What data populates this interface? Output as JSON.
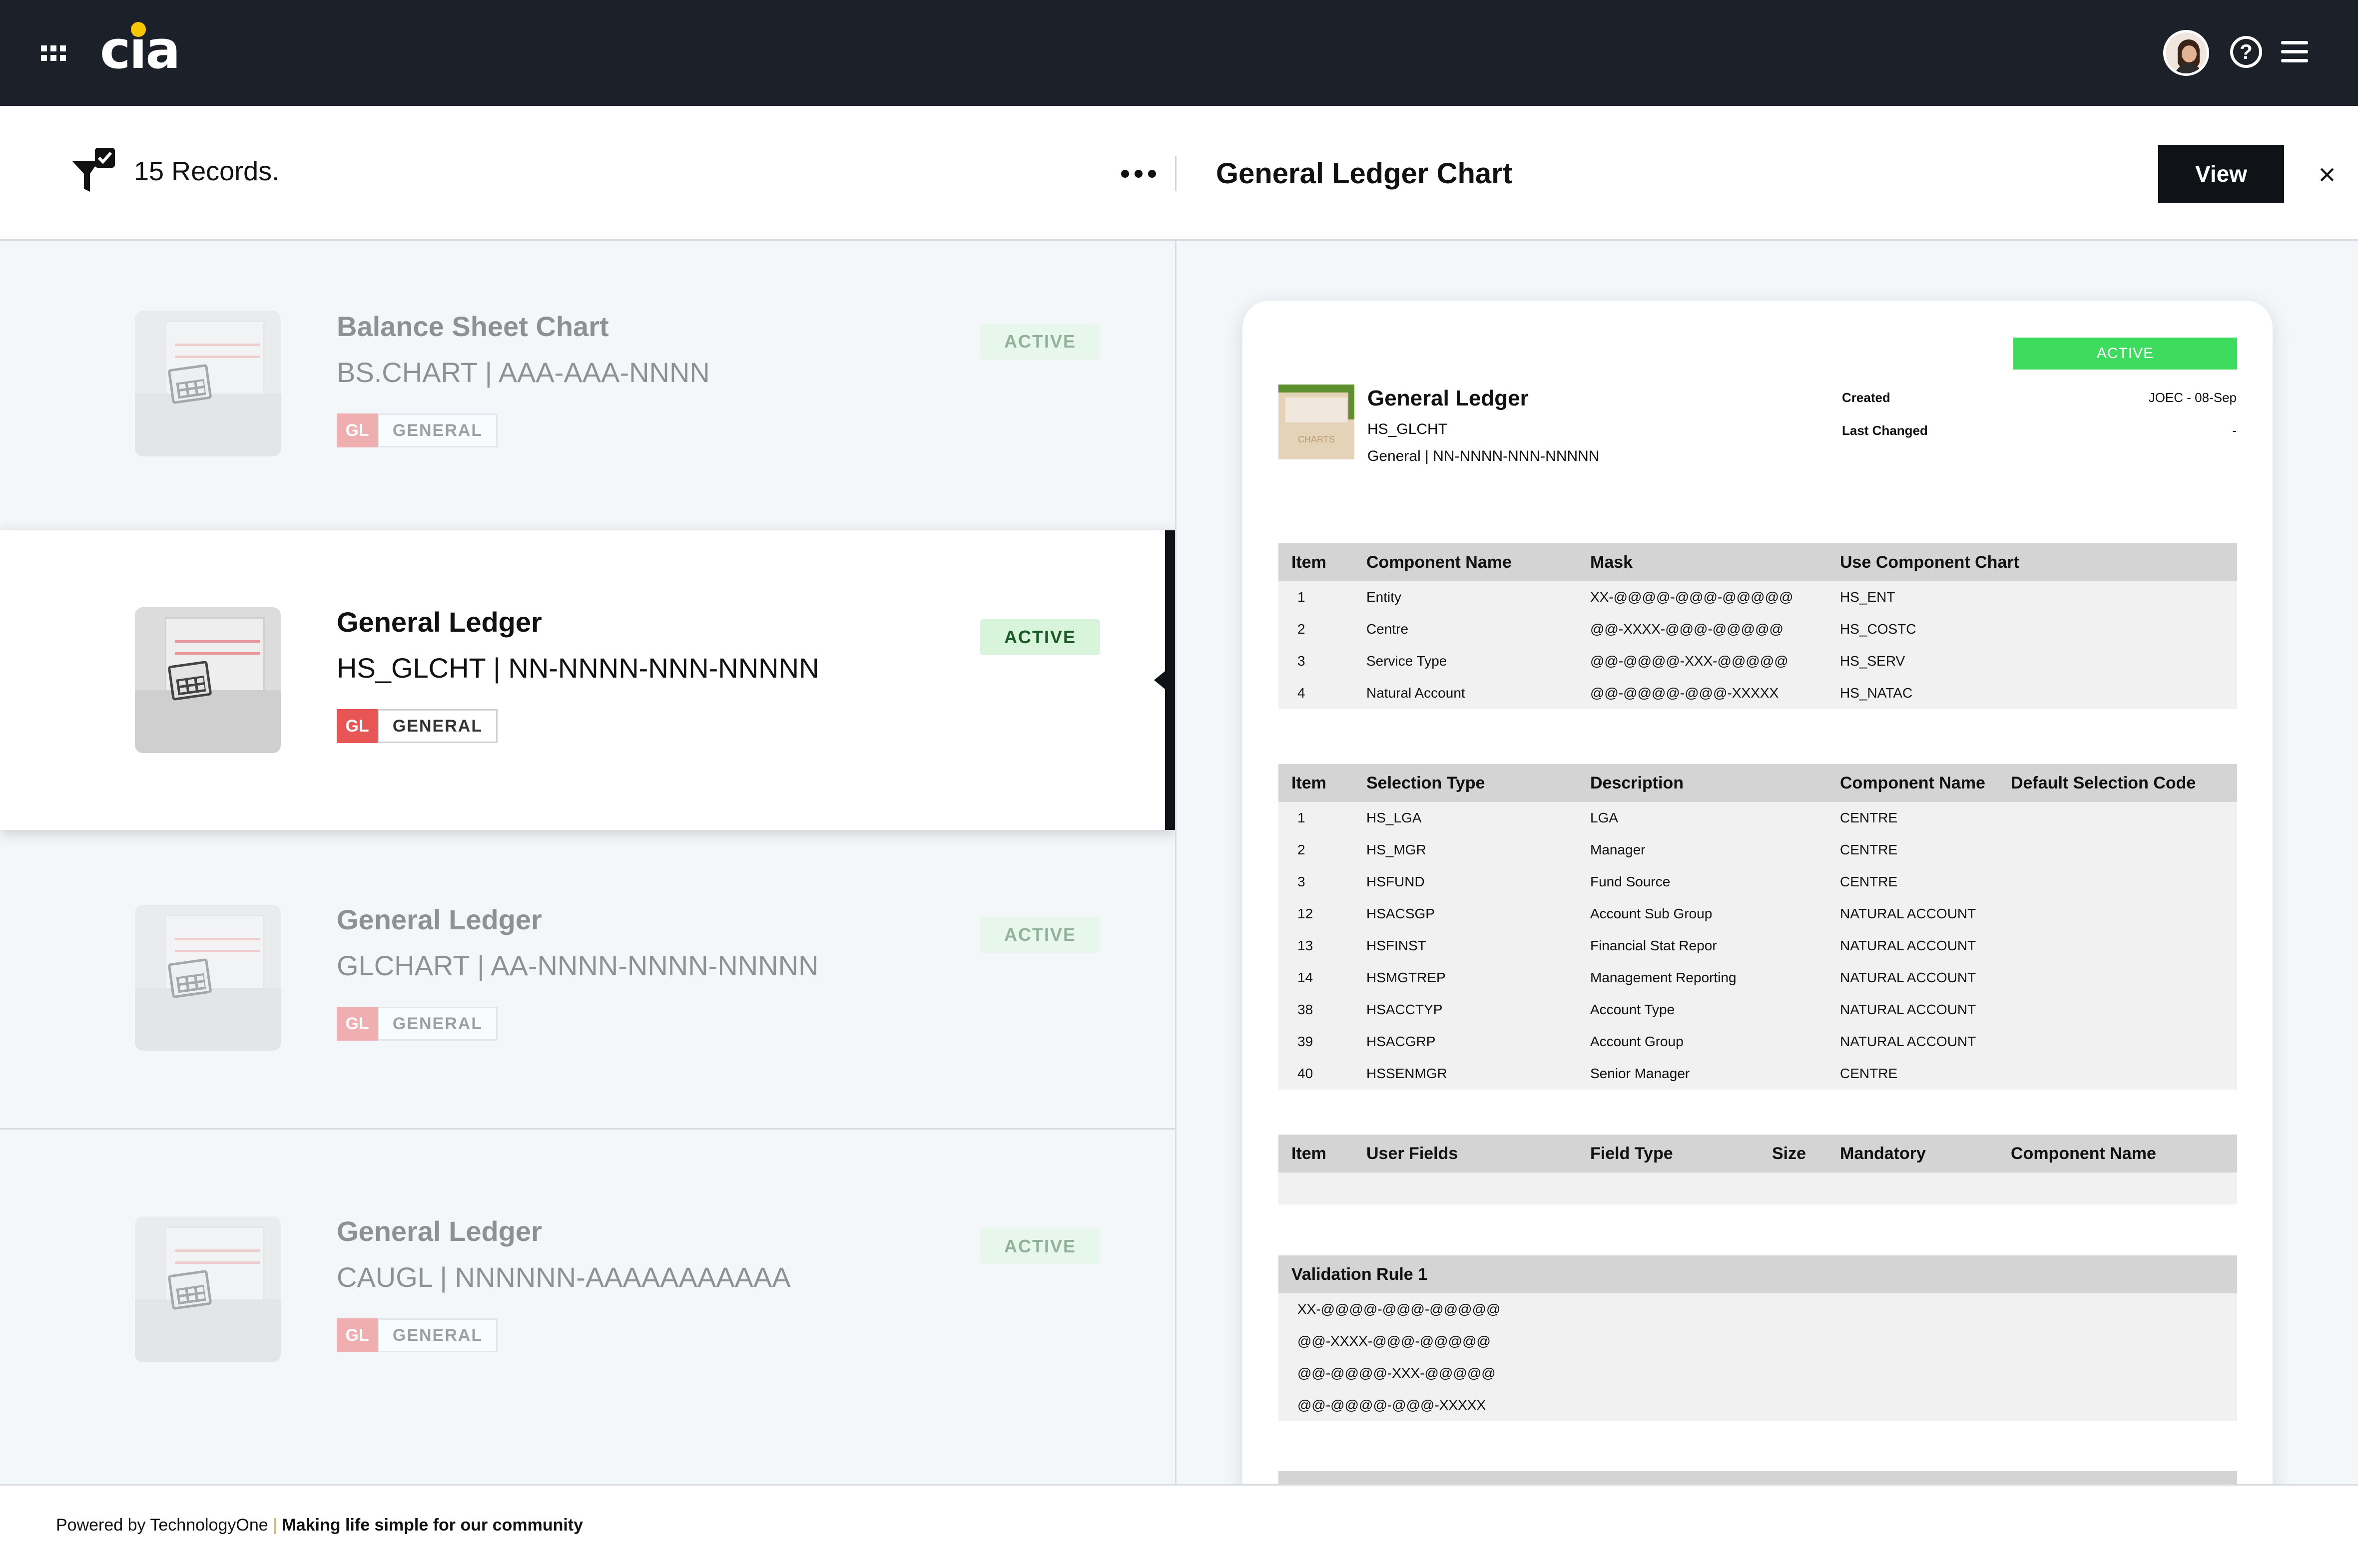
{
  "app": {
    "logo_text": "cia"
  },
  "toolbar": {
    "records_label": "15 Records.",
    "panel_title": "General Ledger Chart",
    "view_label": "View"
  },
  "records": [
    {
      "title": "Balance Sheet Chart",
      "code": "BS.CHART | AAA-AAA-NNNN",
      "tag": "GL",
      "category": "GENERAL",
      "status": "ACTIVE"
    },
    {
      "title": "General Ledger",
      "code": "HS_GLCHT | NN-NNNN-NNN-NNNNN",
      "tag": "GL",
      "category": "GENERAL",
      "status": "ACTIVE"
    },
    {
      "title": "General Ledger",
      "code": "GLCHART | AA-NNNN-NNNN-NNNNN",
      "tag": "GL",
      "category": "GENERAL",
      "status": "ACTIVE"
    },
    {
      "title": "General Ledger",
      "code": "CAUGL | NNNNNN-AAAAAAAAAAA",
      "tag": "GL",
      "category": "GENERAL",
      "status": "ACTIVE"
    }
  ],
  "detail": {
    "status": "ACTIVE",
    "thumb_label": "CHARTS",
    "title": "General Ledger",
    "code": "HS_GLCHT",
    "subtitle": "General | NN-NNNN-NNN-NNNNN",
    "created_label": "Created",
    "created_value": "JOEC - 08-Sep",
    "changed_label": "Last Changed",
    "changed_value": "-",
    "components": {
      "headers": [
        "Item",
        "Component Name",
        "Mask",
        "Use Component Chart"
      ],
      "rows": [
        [
          "1",
          "Entity",
          "XX-@@@@-@@@-@@@@@",
          "HS_ENT"
        ],
        [
          "2",
          "Centre",
          "@@-XXXX-@@@-@@@@@",
          "HS_COSTC"
        ],
        [
          "3",
          "Service Type",
          "@@-@@@@-XXX-@@@@@",
          "HS_SERV"
        ],
        [
          "4",
          "Natural Account",
          "@@-@@@@-@@@-XXXXX",
          "HS_NATAC"
        ]
      ]
    },
    "selections": {
      "headers": [
        "Item",
        "Selection Type",
        "Description",
        "Component Name",
        "Default Selection Code"
      ],
      "rows": [
        [
          "1",
          "HS_LGA",
          "LGA",
          "CENTRE"
        ],
        [
          "2",
          "HS_MGR",
          "Manager",
          "CENTRE"
        ],
        [
          "3",
          "HSFUND",
          "Fund Source",
          "CENTRE"
        ],
        [
          "12",
          "HSACSGP",
          "Account Sub Group",
          "NATURAL ACCOUNT"
        ],
        [
          "13",
          "HSFINST",
          "Financial Stat Repor",
          "NATURAL ACCOUNT"
        ],
        [
          "14",
          "HSMGTREP",
          "Management Reporting",
          "NATURAL ACCOUNT"
        ],
        [
          "38",
          "HSACCTYP",
          "Account Type",
          "NATURAL ACCOUNT"
        ],
        [
          "39",
          "HSACGRP",
          "Account Group",
          "NATURAL ACCOUNT"
        ],
        [
          "40",
          "HSSENMGR",
          "Senior Manager",
          "CENTRE"
        ]
      ]
    },
    "user_fields": {
      "headers": [
        "Item",
        "User Fields",
        "Field Type",
        "Size",
        "Mandatory",
        "Component Name"
      ]
    },
    "validation": {
      "header": "Validation Rule 1",
      "rows": [
        "XX-@@@@-@@@-@@@@@",
        "@@-XXXX-@@@-@@@@@",
        "@@-@@@@-XXX-@@@@@",
        "@@-@@@@-@@@-XXXXX"
      ]
    }
  },
  "footer": {
    "powered": "Powered by TechnologyOne",
    "sep": "|",
    "tagline": "Making life simple for our community"
  }
}
